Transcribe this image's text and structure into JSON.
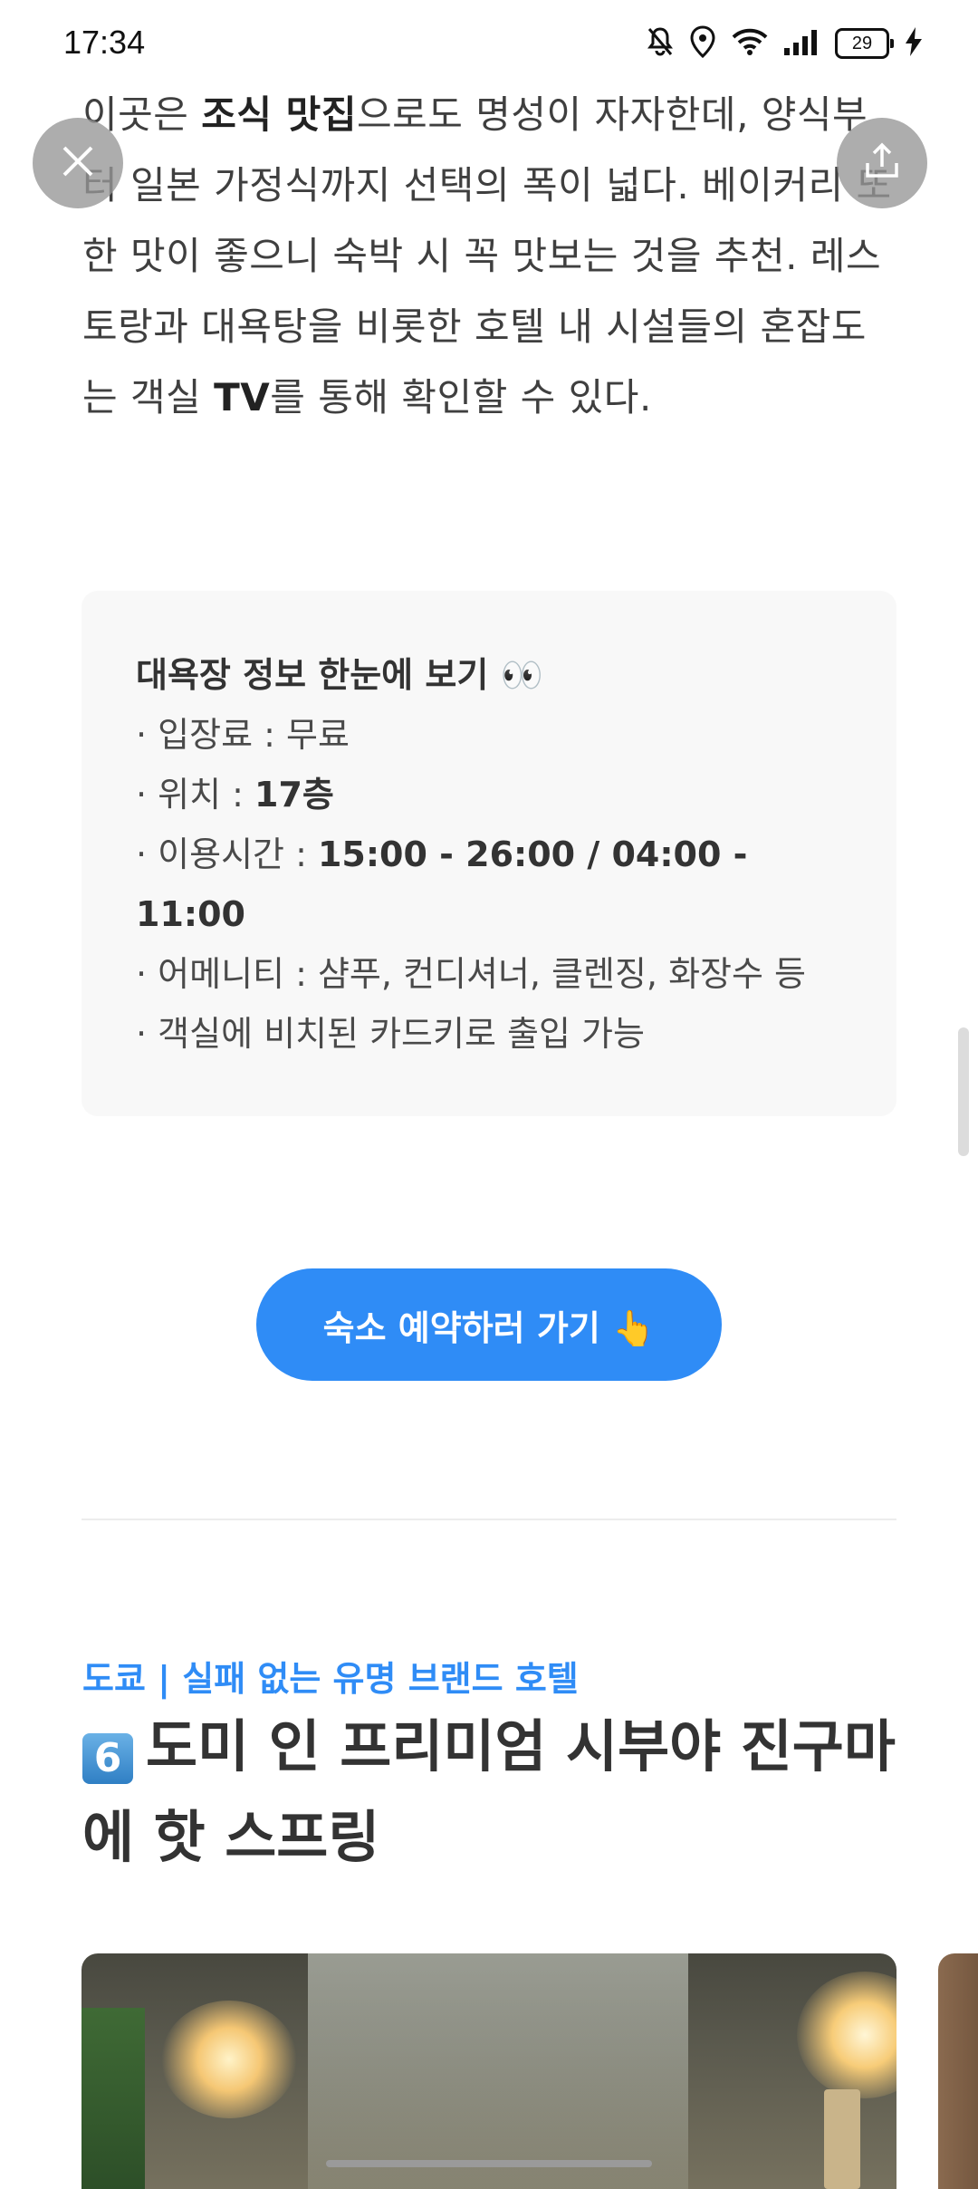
{
  "status_bar": {
    "time": "17:34",
    "battery": "29",
    "icons": [
      "bell-off-icon",
      "location-icon",
      "wifi-icon",
      "signal-icon",
      "battery-icon",
      "charging-icon"
    ]
  },
  "controls": {
    "close_icon": "close-icon",
    "share_icon": "share-icon"
  },
  "article": {
    "intro_lead": "이곳은 ",
    "intro_bold": "조식 맛집",
    "intro_rest": "으로도 명성이 자자한데, 양식부터 일본 가정식까지 선택의 폭이 넓다. 베이커리 또한 맛이 좋으니 숙박 시 꼭 맛보는 것을 추천. 레스토랑과 대욕탕을 비롯한 호텔 내 시설들의 혼잡도는 객실 ",
    "intro_bold2": "TV",
    "intro_tail": "를 통해 확인할 수 있다."
  },
  "info_box": {
    "title": "대욕장 정보 한눈에 보기 👀",
    "items": [
      {
        "label": "· 입장료 : ",
        "value": "무료",
        "strong": false
      },
      {
        "label": "· 위치 : ",
        "value": "17층",
        "strong": true
      },
      {
        "label": "· 이용시간 : ",
        "value": "15:00 - 26:00 / 04:00 - 11:00",
        "strong": true
      },
      {
        "label": "· 어메니티 : ",
        "value": "샴푸, 컨디셔너, 클렌징, 화장수 등",
        "strong": false
      },
      {
        "label": "· 객실에 비치된 카드키로 출입 가능",
        "value": "",
        "strong": false
      }
    ]
  },
  "cta": {
    "label": "숙소 예약하러 가기 👆"
  },
  "section": {
    "tag": "도쿄 | 실패 없는 유명 브랜드 호텔",
    "number": "6",
    "title": "도미 인 프리미엄 시부야 진구마에 핫 스프링"
  },
  "colors": {
    "accent": "#2f8cf6",
    "text": "#333333",
    "box_bg": "#f8f8f8"
  }
}
